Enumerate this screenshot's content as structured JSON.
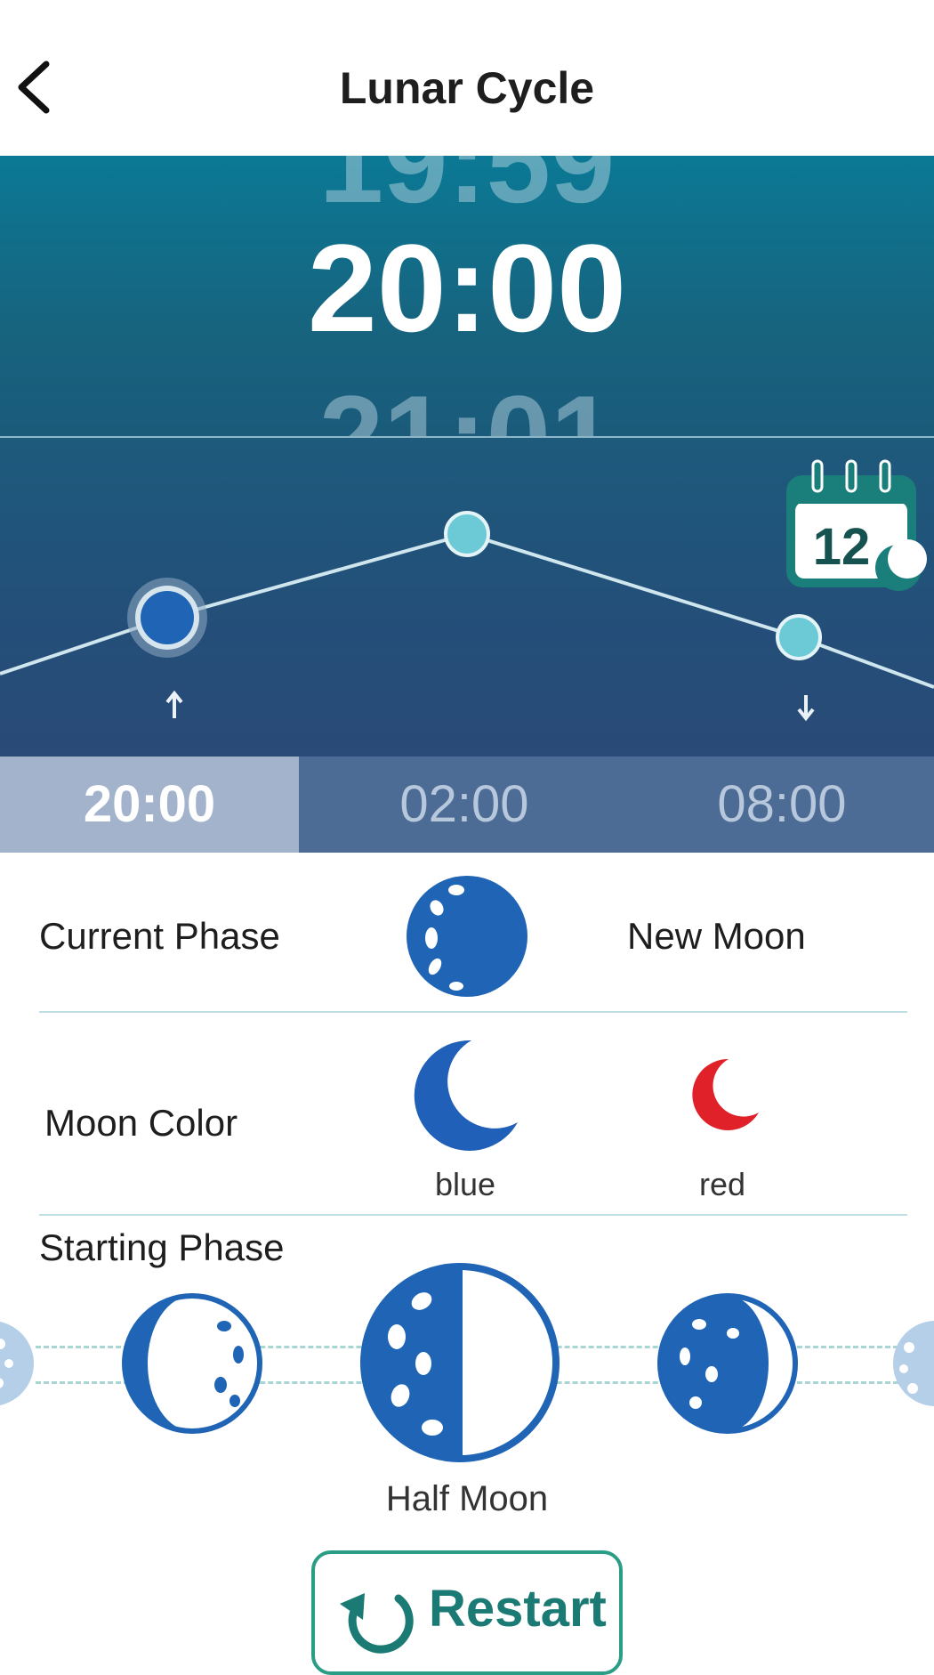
{
  "header": {
    "title": "Lunar Cycle",
    "back_icon": "chevron-left-icon"
  },
  "time_picker": {
    "prev": "19:59",
    "current": "20:00",
    "next": "21:01"
  },
  "chart": {
    "moonrise_icon": "moonrise-icon",
    "moonset_icon": "moonset-icon",
    "calendar_icon": "calendar-moon-icon",
    "calendar_day": "12",
    "accent_color": "#6cc9d6"
  },
  "tabs": [
    {
      "label": "20:00",
      "active": true
    },
    {
      "label": "02:00",
      "active": false
    },
    {
      "label": "08:00",
      "active": false
    }
  ],
  "current_phase": {
    "label": "Current Phase",
    "value": "New Moon",
    "icon": "full-moon-icon"
  },
  "moon_color": {
    "label": "Moon Color",
    "options": [
      {
        "name": "blue",
        "color": "#2160b8"
      },
      {
        "name": "red",
        "color": "#e0212a"
      }
    ]
  },
  "starting_phase": {
    "label": "Starting Phase",
    "selected": "Half Moon"
  },
  "restart": {
    "label": "Restart",
    "icon": "restart-icon"
  }
}
